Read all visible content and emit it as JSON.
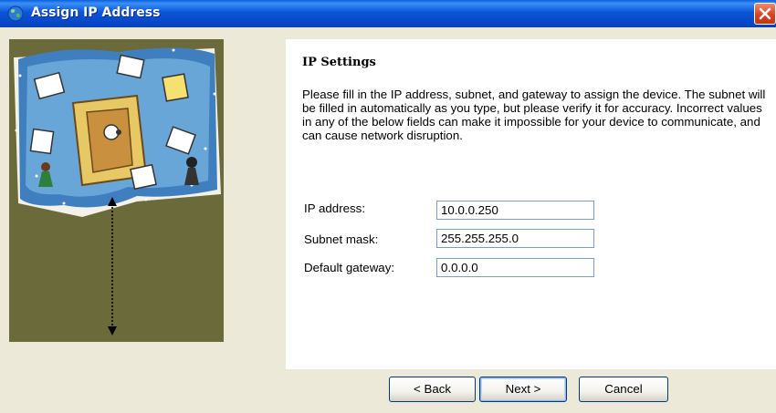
{
  "window": {
    "title": "Assign IP Address"
  },
  "section": {
    "heading": "IP Settings",
    "description": "Please fill in the IP address, subnet, and gateway to assign the device. The subnet will be filled in automatically as you type, but please verify it for accuracy.  Incorrect values in any of the below fields can make it impossible for your device to communicate, and can cause network disruption."
  },
  "fields": {
    "ip": {
      "label": "IP address:",
      "value": "10.0.0.250"
    },
    "subnet": {
      "label": "Subnet mask:",
      "value": "255.255.255.0"
    },
    "gateway": {
      "label": "Default gateway:",
      "value": "0.0.0.0"
    }
  },
  "buttons": {
    "back": "< Back",
    "next": "Next >",
    "cancel": "Cancel"
  },
  "colors": {
    "titlebar": "#0a55d8",
    "panel": "#6b6a3a",
    "close": "#d94320"
  },
  "icons": {
    "window": "globe-icon",
    "close": "close-icon",
    "illustration": "network-illustration",
    "arrow": "vertical-double-arrow-icon"
  }
}
